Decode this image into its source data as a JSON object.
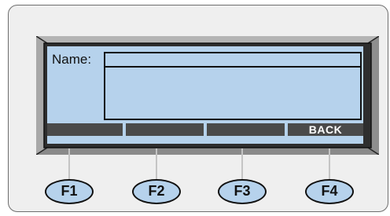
{
  "form": {
    "name_label": "Name:",
    "name_value": "",
    "text_value": ""
  },
  "softkeys": [
    "",
    "",
    "",
    "BACK"
  ],
  "function_keys": [
    "F1",
    "F2",
    "F3",
    "F4"
  ],
  "colors": {
    "screen": "#b6d2ec",
    "bezel_outer": "#9a9a9a",
    "bezel_inner": "#2e2e2e",
    "softkey_bar": "#4a4a4a",
    "device_body": "#efefef"
  }
}
